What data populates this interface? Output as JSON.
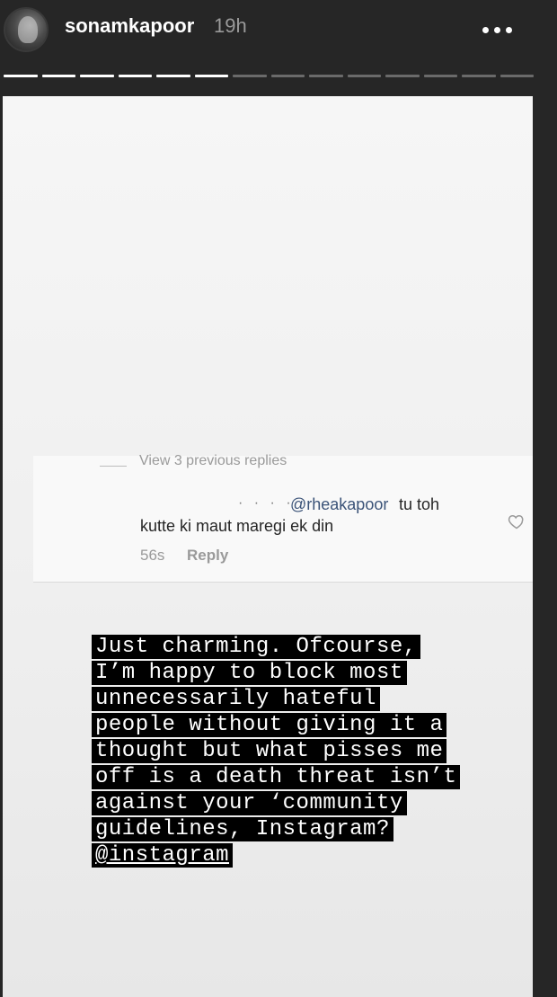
{
  "header": {
    "username": "sonamkapoor",
    "time_ago": "19h",
    "more_icon": "more-horizontal-icon"
  },
  "progress": {
    "segments_total": 14,
    "segments_viewed": 6
  },
  "comment": {
    "view_replies": "View 3 previous replies",
    "commenter": "· · · · ·",
    "mention": "@rheakapoor",
    "text_line1": "tu toh",
    "text_line2": "kutte ki maut maregi ek din",
    "time": "56s",
    "reply_label": "Reply",
    "like_icon": "heart-outline-icon"
  },
  "caption": {
    "lines": [
      "Just charming. Ofcourse,",
      "I’m happy to block most",
      "unnecessarily hateful",
      "people without giving it a",
      "thought but what pisses me",
      "off is a death threat isn’t",
      "against your ‘community",
      "guidelines, Instagram?"
    ],
    "handle": "@instagram"
  },
  "colors": {
    "background": "#262626",
    "mention": "#3b5378",
    "highlight": "#000000"
  }
}
